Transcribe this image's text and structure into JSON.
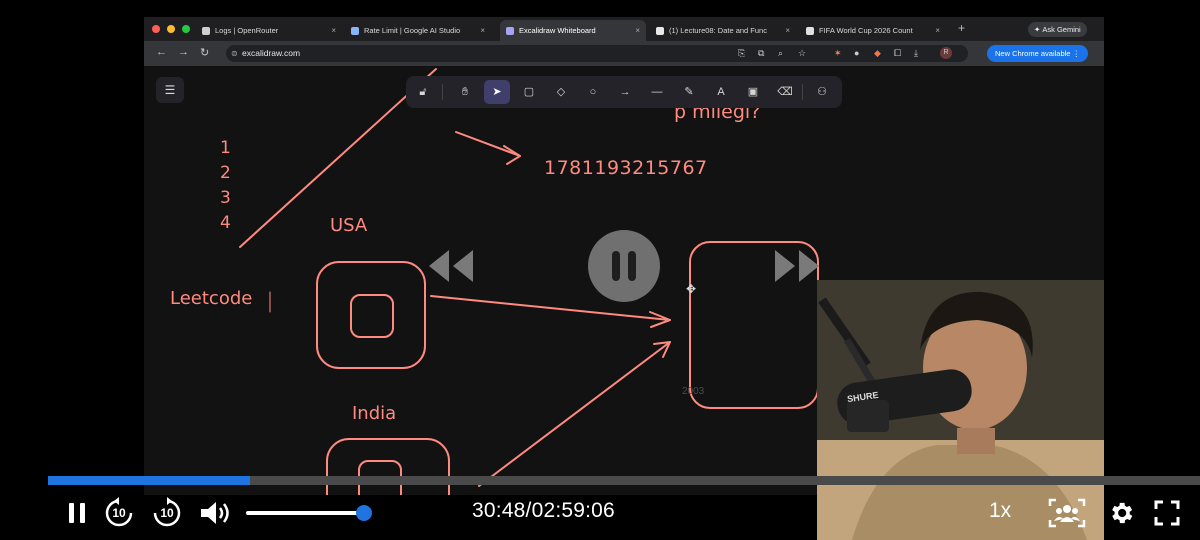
{
  "browser": {
    "tabs": [
      {
        "title": "Logs | OpenRouter",
        "favicon": "openrouter-icon",
        "color": "#cfcfcf",
        "active": false
      },
      {
        "title": "Rate Limit | Google AI Studio",
        "favicon": "ai-studio-icon",
        "color": "#8ab4f8",
        "active": false
      },
      {
        "title": "Excalidraw Whiteboard",
        "favicon": "excalidraw-icon",
        "color": "#a9a3f5",
        "active": true
      },
      {
        "title": "(1) Lecture08: Date and Func",
        "favicon": "notion-icon",
        "color": "#e8e8e8",
        "active": false
      },
      {
        "title": "FIFA World Cup 2026 Count",
        "favicon": "fifa-icon",
        "color": "#e0e0e0",
        "active": false
      }
    ],
    "ask_gemini": "Ask Gemini",
    "url": "excalidraw.com",
    "profile_initial": "R",
    "update_button": "New Chrome available"
  },
  "excalidraw": {
    "tools": [
      "lock-icon",
      "hand-icon",
      "selection-icon",
      "rectangle-icon",
      "diamond-icon",
      "ellipse-icon",
      "arrow-icon",
      "line-icon",
      "pencil-icon",
      "text-icon",
      "image-icon",
      "eraser-icon",
      "more-tools-icon"
    ],
    "selected_tool": "selection-icon"
  },
  "drawing": {
    "partial_text": "p milegi?",
    "numbers": [
      "1",
      "2",
      "3",
      "4"
    ],
    "id_value": "1781193215767",
    "label_usa": "USA",
    "label_india": "India",
    "label_leetcode": "Leetcode",
    "faint_code": "2003",
    "stroke_color": "#ff8a80"
  },
  "player": {
    "progress_fraction": 0.175,
    "volume_fraction": 1.0,
    "current_time": "30:48",
    "total_time": "02:59:06",
    "time_display": "30:48/02:59:06",
    "skip_seconds": "10",
    "speed": "1x",
    "accent_color": "#1f74e0"
  },
  "webcam": {
    "mic_brand": "SHURE"
  }
}
